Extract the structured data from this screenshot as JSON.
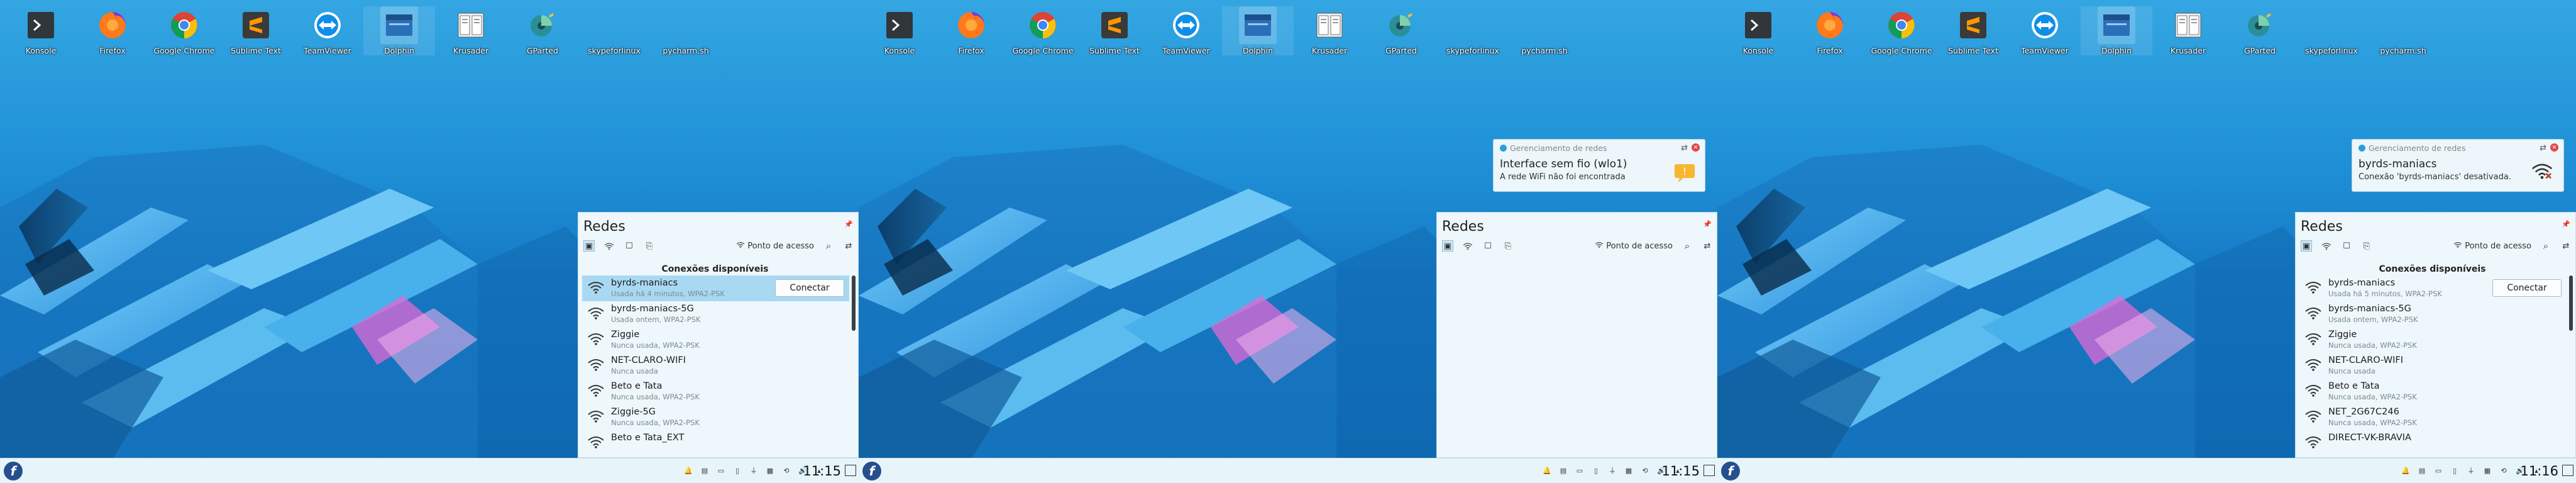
{
  "desktop": {
    "icons": [
      {
        "label": "Konsole",
        "icon": "terminal-icon"
      },
      {
        "label": "Firefox",
        "icon": "firefox-icon"
      },
      {
        "label": "Google Chrome",
        "icon": "chrome-icon"
      },
      {
        "label": "Sublime Text",
        "icon": "sublime-icon"
      },
      {
        "label": "TeamViewer",
        "icon": "teamviewer-icon"
      },
      {
        "label": "Dolphin",
        "icon": "dolphin-icon"
      },
      {
        "label": "Krusader",
        "icon": "krusader-icon"
      },
      {
        "label": "GParted",
        "icon": "gparted-icon"
      },
      {
        "label": "skypeforlinux",
        "icon": "none"
      },
      {
        "label": "pycharm.sh",
        "icon": "none"
      }
    ]
  },
  "screens": [
    {
      "notification": null,
      "panel": {
        "title": "Redes",
        "hotspot": "Ponto de acesso",
        "section": "Conexões disponíveis",
        "networks": [
          {
            "name": "byrds-maniacs",
            "status": "Usada há 4 minutos, WPA2-PSK",
            "button": "Conectar",
            "highlighted": true
          },
          {
            "name": "byrds-maniacs-5G",
            "status": "Usada ontem, WPA2-PSK"
          },
          {
            "name": "Ziggie",
            "status": "Nunca usada, WPA2-PSK"
          },
          {
            "name": "NET-CLARO-WIFI",
            "status": "Nunca usada"
          },
          {
            "name": "Beto e Tata",
            "status": "Nunca usada, WPA2-PSK"
          },
          {
            "name": "Ziggie-5G",
            "status": "Nunca usada, WPA2-PSK"
          },
          {
            "name": "Beto e Tata_EXT",
            "status": ""
          }
        ]
      },
      "clock": "11:15"
    },
    {
      "notification": {
        "app": "Gerenciamento de redes",
        "title": "Interface sem fio (wlo1)",
        "message": "A rede WiFi não foi encontrada",
        "image": "warning"
      },
      "panel": {
        "title": "Redes",
        "hotspot": "Ponto de acesso",
        "section": "",
        "networks": []
      },
      "clock": "11:15"
    },
    {
      "notification": {
        "app": "Gerenciamento de redes",
        "title": "byrds-maniacs",
        "message": "Conexão 'byrds-maniacs' desativada.",
        "image": "wifi-off"
      },
      "panel": {
        "title": "Redes",
        "hotspot": "Ponto de acesso",
        "section": "Conexões disponíveis",
        "networks": [
          {
            "name": "byrds-maniacs",
            "status": "Usada há 5 minutos, WPA2-PSK",
            "button": "Conectar",
            "highlighted": false
          },
          {
            "name": "byrds-maniacs-5G",
            "status": "Usada ontem, WPA2-PSK"
          },
          {
            "name": "Ziggie",
            "status": "Nunca usada, WPA2-PSK"
          },
          {
            "name": "NET-CLARO-WIFI",
            "status": "Nunca usada"
          },
          {
            "name": "Beto e Tata",
            "status": "Nunca usada, WPA2-PSK"
          },
          {
            "name": "NET_2G67C246",
            "status": "Nunca usada, WPA2-PSK"
          },
          {
            "name": "DIRECT-VK-BRAVIA",
            "status": ""
          }
        ]
      },
      "clock": "11:16"
    }
  ],
  "colors": {
    "accent": "#3daee9",
    "panel": "#eef7fb",
    "highlight": "#a9d9f2"
  }
}
